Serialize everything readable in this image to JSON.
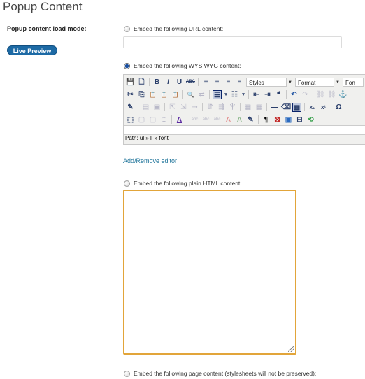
{
  "page": {
    "title": "Popup Content"
  },
  "settings": {
    "load_mode_label": "Popup content load mode:",
    "live_preview_label": "Live Preview"
  },
  "options": {
    "url": {
      "label": "Embed the following URL content:",
      "checked": false,
      "value": "",
      "placeholder": ""
    },
    "wysiwyg": {
      "label": "Embed the following WYSIWYG content:",
      "checked": true
    },
    "plain_html": {
      "label": "Embed the following plain HTML content:",
      "checked": false,
      "value": ""
    },
    "page": {
      "label": "Embed the following page content (stylesheets will not be preserved):",
      "checked": false
    }
  },
  "editor": {
    "toolbar_row1": [
      "save",
      "new-document",
      "bold",
      "italic",
      "underline",
      "strikethrough",
      "align-left",
      "align-center",
      "align-right",
      "align-justify"
    ],
    "styles_select": "Styles",
    "format_select": "Format",
    "font_select": "Fon",
    "toolbar_row2": [
      "cut",
      "copy",
      "paste",
      "paste-text",
      "paste-word",
      "find",
      "replace",
      "bullet-list",
      "numbered-list",
      "outdent",
      "indent",
      "blockquote",
      "undo",
      "redo",
      "link",
      "unlink",
      "anchor"
    ],
    "toolbar_row3": [
      "edit-css",
      "insert-row",
      "delete-row",
      "col-before",
      "col-after",
      "delete-col",
      "split-cells",
      "merge-cells",
      "table-props",
      "cell-props",
      "horizontal-rule",
      "remove-format",
      "visual-aid",
      "subscript",
      "superscript",
      "special-char"
    ],
    "toolbar_row4": [
      "insert-layer",
      "move-forward",
      "move-backward",
      "absolute",
      "styleprops",
      "cite",
      "abbr",
      "acronym",
      "del",
      "ins",
      "attribs",
      "show-blocks",
      "nonbreaking",
      "template",
      "pagebreak",
      "restore-draft"
    ],
    "path": "Path: ul » li » font"
  },
  "links": {
    "add_remove_editor": "Add/Remove editor"
  },
  "icons": {
    "row1": [
      "💾",
      "🗋",
      "B",
      "I",
      "U",
      "ABC",
      "≡",
      "≡",
      "≡",
      "≡"
    ],
    "row2": [
      "✂",
      "⎘",
      "📋",
      "📋",
      "📋",
      "🔍",
      "⇄",
      "☰",
      "▾",
      "☷",
      "▾",
      "⇤",
      "⇥",
      "❝",
      "↶",
      "↷",
      "⛓",
      "⛓",
      "⚓"
    ],
    "row3": [
      "✎",
      "▤",
      "▣",
      "⇱",
      "⇲",
      "⇸",
      "⇵",
      "⇶",
      "Ⲯ",
      "▦",
      "▦",
      "—",
      "⌫",
      "▦",
      "x₁",
      "x¹",
      "Ω"
    ],
    "row4": [
      "⬚",
      "▢",
      "▢",
      "↥",
      "A",
      "abc",
      "abc",
      "abc",
      "A",
      "A",
      "✎",
      "¶",
      "⊠",
      "▣",
      "⊟",
      "⟲"
    ]
  }
}
